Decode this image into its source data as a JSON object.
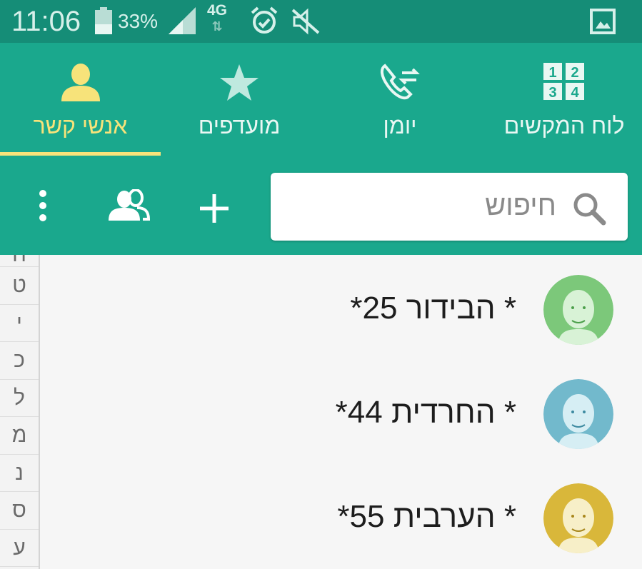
{
  "status_bar": {
    "time": "11:06",
    "battery_percent": "33%",
    "network_type": "4G",
    "network_arrows": "⇅",
    "icons": [
      "battery-icon",
      "signal-icon",
      "alarm-icon",
      "mute-icon",
      "gallery-icon"
    ]
  },
  "tabs": [
    {
      "label": "לוח המקשים",
      "icon": "dialpad-icon",
      "active": false
    },
    {
      "label": "יומן",
      "icon": "call-log-icon",
      "active": false
    },
    {
      "label": "מועדפים",
      "icon": "star-icon",
      "active": false
    },
    {
      "label": "אנשי קשר",
      "icon": "person-icon",
      "active": true
    }
  ],
  "dialpad_digits": [
    "1",
    "2",
    "3",
    "4"
  ],
  "search": {
    "placeholder": "חיפוש"
  },
  "toolbar": {
    "icons": [
      "add-icon",
      "groups-icon",
      "more-icon"
    ]
  },
  "index_letters": [
    "ח",
    "ט",
    "י",
    "כ",
    "ל",
    "מ",
    "נ",
    "ס",
    "ע"
  ],
  "contacts": [
    {
      "name": "* הבידור 25*",
      "avatar_color": "#7cc87a"
    },
    {
      "name": "* החרדית 44*",
      "avatar_color": "#72b9cc"
    },
    {
      "name": "* הערבית 55*",
      "avatar_color": "#d9b73a"
    }
  ],
  "colors": {
    "status_bar": "#158d77",
    "header": "#1aa88d",
    "active_tab": "#f7e37a",
    "list_bg": "#f6f6f6"
  }
}
